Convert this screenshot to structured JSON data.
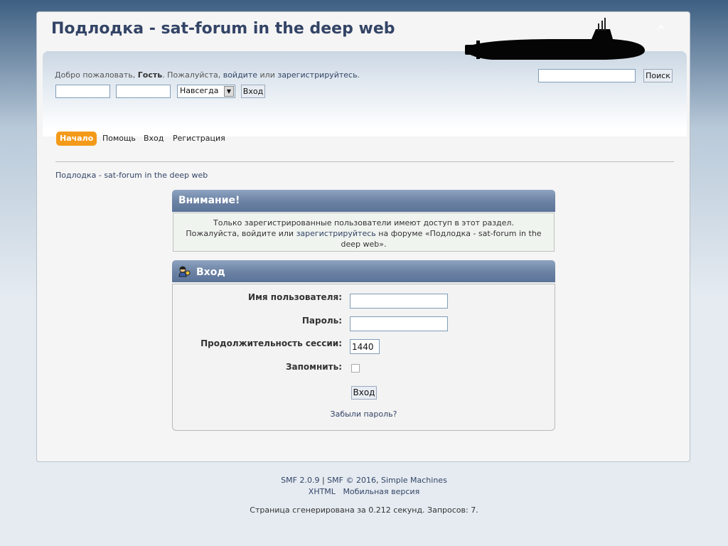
{
  "header": {
    "forum_title": "Подлодка - sat-forum in the deep web",
    "upshrink_glyph": "^",
    "welcome_prefix": "Добро пожаловать, ",
    "welcome_guest": "Гость",
    "welcome_mid": ". Пожалуйста, ",
    "welcome_login_link": "войдите",
    "welcome_or": " или ",
    "welcome_register_link": "зарегистрируйтесь",
    "welcome_suffix": ".",
    "session_select_value": "Навсегда",
    "quick_login_button": "Вход",
    "search_button": "Поиск",
    "search_value": ""
  },
  "menu": {
    "items": [
      {
        "label": "Начало",
        "active": true
      },
      {
        "label": "Помощь",
        "active": false
      },
      {
        "label": "Вход",
        "active": false
      },
      {
        "label": "Регистрация",
        "active": false
      }
    ]
  },
  "linktree": {
    "label": "Подлодка - sat-forum in the deep web"
  },
  "notice": {
    "title": "Внимание!",
    "line1": "Только зарегистрированные пользователи имеют доступ в этот раздел.",
    "line2_prefix": "Пожалуйста, войдите или ",
    "line2_link": "зарегистрируйтесь",
    "line2_suffix": " на форуме «Подлодка - sat-forum in the",
    "line3": "deep web»."
  },
  "login": {
    "title": "Вход",
    "username_label": "Имя пользователя:",
    "password_label": "Пароль:",
    "session_label": "Продолжительность сессии:",
    "session_value": "1440",
    "remember_label": "Запомнить:",
    "remember_checked": false,
    "submit_label": "Вход",
    "forgot_link": "Забыли пароль?"
  },
  "footer": {
    "smf_version": "SMF 2.0.9",
    "separator": " | ",
    "smf_copyright": "SMF © 2016",
    "comma": ", ",
    "simple_machines": "Simple Machines",
    "xhtml": "XHTML",
    "mobile": "Мобильная версия",
    "page_generated": "Страница сгенерирована за 0.212 секунд. Запросов: 7."
  },
  "colors": {
    "accent_orange": "#f49a1a",
    "title_blue": "#334466",
    "catbar_blue": "#6c83a5"
  }
}
